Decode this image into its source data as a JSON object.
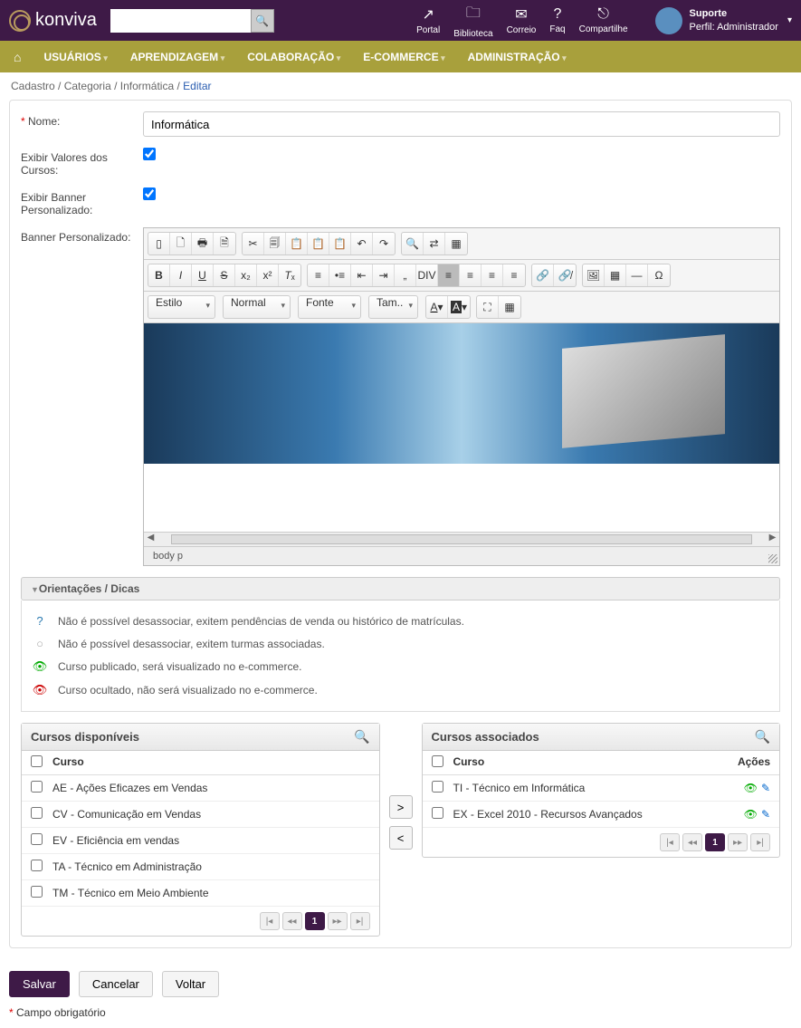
{
  "header": {
    "logo": "konviva",
    "icons": [
      {
        "label": "Portal",
        "glyph": "↗"
      },
      {
        "label": "Biblioteca",
        "glyph": "🗀"
      },
      {
        "label": "Correio",
        "glyph": "✉"
      },
      {
        "label": "Faq",
        "glyph": "?"
      },
      {
        "label": "Compartilhe",
        "glyph": "⎋"
      }
    ],
    "user": {
      "name": "Suporte",
      "role": "Perfil: Administrador"
    }
  },
  "nav": [
    "USUÁRIOS",
    "APRENDIZAGEM",
    "COLABORAÇÃO",
    "E-COMMERCE",
    "ADMINISTRAÇÃO"
  ],
  "breadcrumb": {
    "a": "Cadastro",
    "b": "Categoria",
    "c": "Informática",
    "current": "Editar"
  },
  "form": {
    "nome_label": "Nome:",
    "nome_value": "Informática",
    "exibir_valores_label": "Exibir Valores dos Cursos:",
    "exibir_banner_label": "Exibir Banner Personalizado:",
    "banner_label": "Banner Personalizado:"
  },
  "editor": {
    "selects": {
      "estilo": "Estilo",
      "normal": "Normal",
      "fonte": "Fonte",
      "tam": "Tam..",
      "fcolor": "A",
      "bcolor": "A"
    },
    "path": "body   p"
  },
  "tips": {
    "header": "Orientações / Dicas",
    "rows": [
      {
        "icon": "info",
        "glyph": "?",
        "text": "Não é possível desassociar, exitem pendências de venda ou histórico de matrículas."
      },
      {
        "icon": "gray",
        "glyph": "○",
        "text": "Não é possível desassociar, exitem turmas associadas."
      },
      {
        "icon": "green",
        "glyph": "👁",
        "text": "Curso publicado, será visualizado no e-commerce."
      },
      {
        "icon": "red",
        "glyph": "👁",
        "text": "Curso ocultado, não será visualizado no e-commerce."
      }
    ]
  },
  "available": {
    "title": "Cursos disponíveis",
    "col": "Curso",
    "rows": [
      "AE - Ações Eficazes em Vendas",
      "CV - Comunicação em Vendas",
      "EV - Eficiência em vendas",
      "TA - Técnico em Administração",
      "TM - Técnico em Meio Ambiente"
    ],
    "page": "1"
  },
  "associated": {
    "title": "Cursos associados",
    "col": "Curso",
    "col_actions": "Ações",
    "rows": [
      "TI - Técnico em Informática",
      "EX - Excel 2010 - Recursos Avançados"
    ],
    "page": "1"
  },
  "buttons": {
    "save": "Salvar",
    "cancel": "Cancelar",
    "back": "Voltar"
  },
  "footnote": "Campo obrigatório"
}
